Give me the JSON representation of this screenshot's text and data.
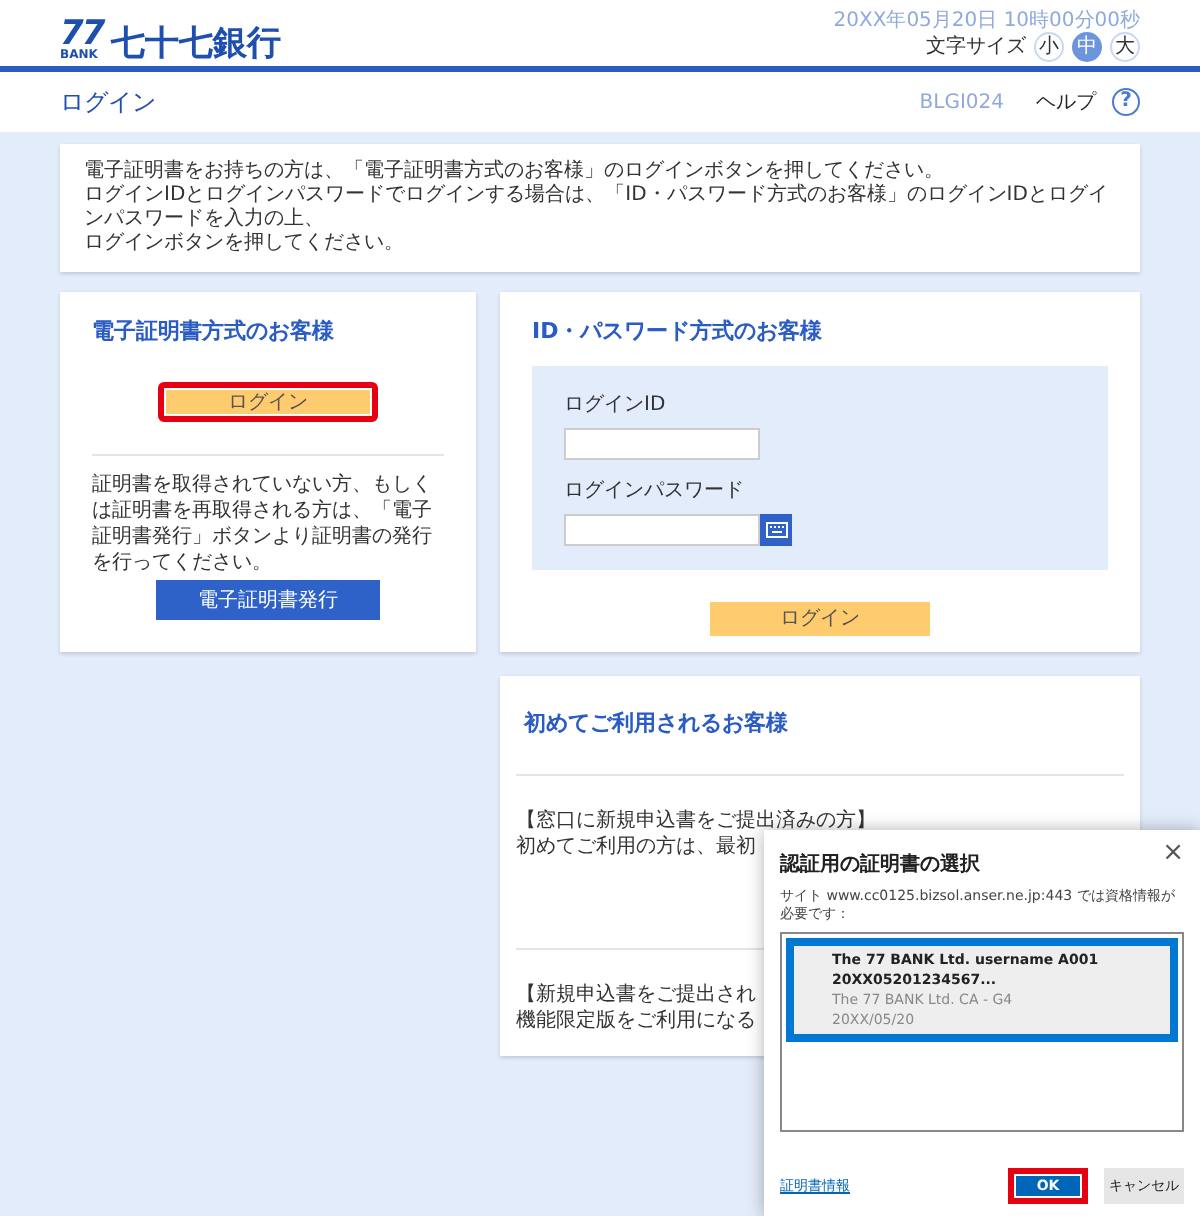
{
  "header": {
    "logo_number": "77",
    "logo_sub": "BANK",
    "bank_name": "七十七銀行",
    "datetime": "20XX年05月20日 10時00分00秒",
    "font_size_label": "文字サイズ",
    "font_sizes": [
      {
        "label": "小",
        "selected": false
      },
      {
        "label": "中",
        "selected": true
      },
      {
        "label": "大",
        "selected": false
      }
    ]
  },
  "title_bar": {
    "title": "ログイン",
    "screen_id": "BLGI024",
    "help": "ヘルプ",
    "help_icon": "?"
  },
  "notice": {
    "lines": [
      "電子証明書をお持ちの方は、「電子証明書方式のお客様」のログインボタンを押してください。",
      "ログインIDとログインパスワードでログインする場合は、「ID・パスワード方式のお客様」のログインIDとログインパスワードを入力の上、",
      "ログインボタンを押してください。"
    ]
  },
  "certificate_card": {
    "title": "電子証明書方式のお客様",
    "login_button": {
      "label": "ログイン",
      "highlighted": true
    },
    "description": "証明書を取得されていない方、もしくは証明書を再取得される方は、「電子証明書発行」ボタンより証明書の発行を行ってください。",
    "issue_button": "電子証明書発行"
  },
  "password_card": {
    "title": "ID・パスワード方式のお客様",
    "fields": [
      {
        "label": "ログインID",
        "kind": "text"
      },
      {
        "label": "ログインパスワード",
        "kind": "password"
      }
    ],
    "login_button": {
      "label": "ログイン",
      "highlighted": false
    }
  },
  "first_time_card": {
    "title": "初めてご利用されるお客様",
    "sections": [
      {
        "lines": [
          "【窓口に新規申込書をご提出済みの方】",
          "初めてご利用の方は、最初"
        ]
      },
      {
        "lines": [
          "【新規申込書をご提出され",
          "機能限定版をご利用になる"
        ]
      }
    ]
  },
  "certificate_dialog": {
    "title": "認証用の証明書の選択",
    "close": "×",
    "message": "サイト www.cc0125.bizsol.anser.ne.jp:443 では資格情報が必要です：",
    "certificates": [
      {
        "subject": "The 77 BANK Ltd. username A001 20XX05201234567...",
        "issuer": "The 77 BANK Ltd. CA - G4",
        "date": "20XX/05/20",
        "selected": true,
        "highlighted": true
      }
    ],
    "info_link": "証明書情報",
    "buttons": [
      {
        "label": "OK",
        "kind": "primary",
        "highlighted": true
      },
      {
        "label": "キャンセル",
        "kind": "secondary",
        "highlighted": false
      }
    ]
  }
}
